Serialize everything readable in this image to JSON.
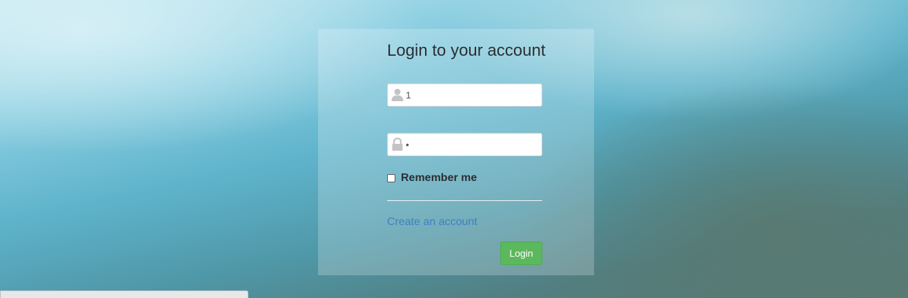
{
  "login_form": {
    "title": "Login to your account",
    "username": {
      "value": "1",
      "icon": "user-icon"
    },
    "password": {
      "value": "•",
      "icon": "lock-icon"
    },
    "remember": {
      "label": "Remember me",
      "checked": false
    },
    "create_account_link": "Create an account",
    "login_button": "Login"
  },
  "colors": {
    "login_button": "#5cb85c",
    "link": "#3f7fc0",
    "title_text": "#2b2f33"
  }
}
